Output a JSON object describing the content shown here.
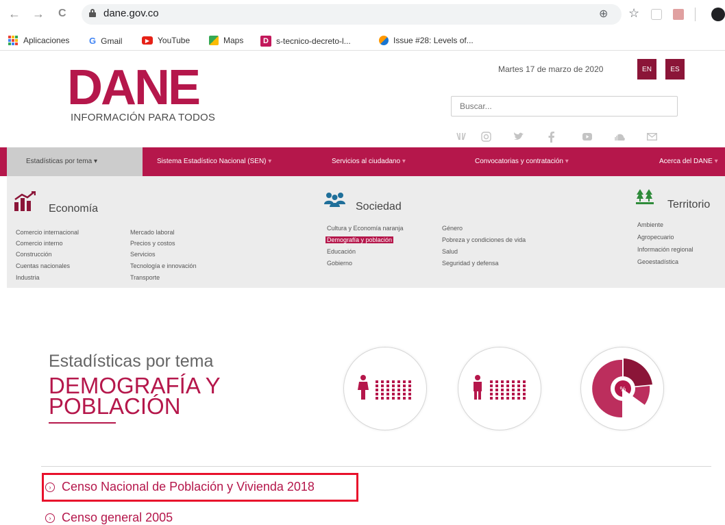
{
  "browser": {
    "back": "←",
    "forward": "→",
    "reload": "C",
    "url": "dane.gov.co",
    "zoom_icon": "⊕",
    "star_icon": "☆",
    "bookmarks": [
      {
        "label": "Aplicaciones",
        "icon": "apps-icon"
      },
      {
        "label": "Gmail",
        "icon": "G"
      },
      {
        "label": "YouTube",
        "icon": "▶"
      },
      {
        "label": "Maps",
        "icon": "maps-icon"
      },
      {
        "label": "s-tecnico-decreto-l...",
        "icon": "D"
      },
      {
        "label": "Issue #28: Levels of...",
        "icon": "issue-icon"
      }
    ]
  },
  "header": {
    "logo": "DANE",
    "logo_sub": "INFORMACIÓN PARA TODOS",
    "date": "Martes 17 de marzo de 2020",
    "lang_en": "EN",
    "lang_es": "ES",
    "search_placeholder": "Buscar..."
  },
  "nav": {
    "items": [
      {
        "label": "Estadísticas por tema"
      },
      {
        "label": "Sistema Estadístico Nacional (SEN)"
      },
      {
        "label": "Servicios al ciudadano"
      },
      {
        "label": "Convocatorias y contratación"
      },
      {
        "label": "Acerca del DANE"
      }
    ],
    "caret": "▾"
  },
  "mega": {
    "economia": {
      "title": "Economía",
      "col1": [
        "Comercio internacional",
        "Comercio interno",
        "Construcción",
        "Cuentas nacionales",
        "Industria"
      ],
      "col2": [
        "Mercado laboral",
        "Precios y costos",
        "Servicios",
        "Tecnología e innovación",
        "Transporte"
      ]
    },
    "sociedad": {
      "title": "Sociedad",
      "col1": [
        "Cultura y Economía naranja",
        "Demografía y población",
        "Educación",
        "Gobierno"
      ],
      "col2": [
        "Género",
        "Pobreza y condiciones de vida",
        "Salud",
        "Seguridad y defensa"
      ]
    },
    "territorio": {
      "title": "Territorio",
      "col1": [
        "Ambiente",
        "Agropecuario",
        "Información regional",
        "Geoestadística"
      ]
    }
  },
  "section": {
    "label": "Estadísticas por tema",
    "title_line1": "DEMOGRAFÍA Y",
    "title_line2": "POBLACIÓN"
  },
  "list": [
    {
      "label": "Censo Nacional de Población y Vivienda 2018"
    },
    {
      "label": "Censo general 2005"
    }
  ],
  "colors": {
    "brand": "#b5174b",
    "dark_brand": "#8b1538",
    "highlight": "#e8102b"
  }
}
